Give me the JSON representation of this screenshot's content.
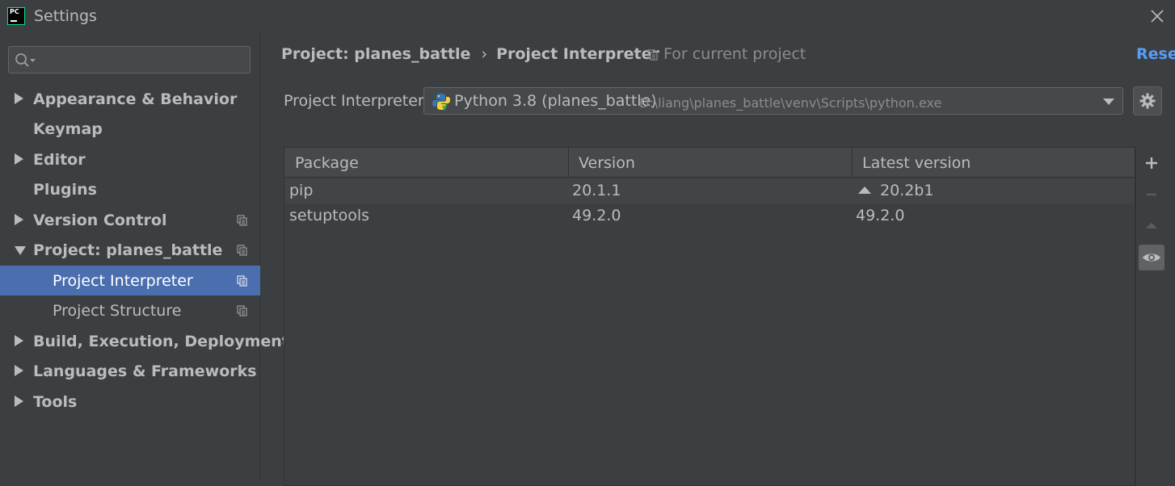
{
  "window": {
    "title": "Settings"
  },
  "sidebar": {
    "search_placeholder": "",
    "items": [
      {
        "label": "Appearance & Behavior"
      },
      {
        "label": "Keymap"
      },
      {
        "label": "Editor"
      },
      {
        "label": "Plugins"
      },
      {
        "label": "Version Control"
      },
      {
        "label": "Project: planes_battle"
      },
      {
        "label": "Project Interpreter"
      },
      {
        "label": "Project Structure"
      },
      {
        "label": "Build, Execution, Deployment"
      },
      {
        "label": "Languages & Frameworks"
      },
      {
        "label": "Tools"
      }
    ]
  },
  "header": {
    "breadcrumb_parent": "Project: planes_battle",
    "breadcrumb_separator": "›",
    "breadcrumb_current": "Project Interpreter",
    "scope_text": "For current project",
    "reset_label": "Reset"
  },
  "interpreter": {
    "label": "Project Interpreter:",
    "name": "Python 3.8 (planes_battle)",
    "path": "D:\\liang\\planes_battle\\venv\\Scripts\\python.exe"
  },
  "packages": {
    "columns": [
      "Package",
      "Version",
      "Latest version"
    ],
    "rows": [
      {
        "package": "pip",
        "version": "20.1.1",
        "latest": "20.2b1",
        "upgrade_available": true
      },
      {
        "package": "setuptools",
        "version": "49.2.0",
        "latest": "49.2.0",
        "upgrade_available": false
      }
    ]
  },
  "colors": {
    "background": "#3c3f41",
    "selection": "#4b6eaf",
    "link": "#589df6",
    "text": "#bbbbbb"
  },
  "icons": [
    "pycharm-logo-icon",
    "close-icon",
    "search-icon",
    "copy-scope-icon",
    "python-icon",
    "gear-icon",
    "add-icon",
    "remove-icon",
    "upgrade-icon",
    "eye-icon"
  ]
}
